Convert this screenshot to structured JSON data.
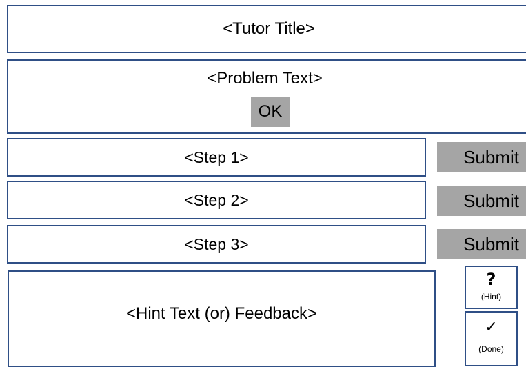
{
  "tutor": {
    "title": "<Tutor Title>"
  },
  "problem": {
    "text": "<Problem Text>",
    "ok_label": "OK"
  },
  "steps": [
    {
      "label": "<Step 1>",
      "submit_label": "Submit"
    },
    {
      "label": "<Step 2>",
      "submit_label": "Submit"
    },
    {
      "label": "<Step 3>",
      "submit_label": "Submit"
    }
  ],
  "feedback": {
    "text": "<Hint Text (or) Feedback>"
  },
  "hint_button": {
    "icon": "question-mark-icon",
    "glyph": "?",
    "label": "(Hint)"
  },
  "done_button": {
    "icon": "checkmark-icon",
    "glyph": "✓",
    "label": "(Done)"
  },
  "colors": {
    "border": "#2f4f86",
    "button_fill": "#a5a5a5",
    "background": "#ffffff"
  }
}
